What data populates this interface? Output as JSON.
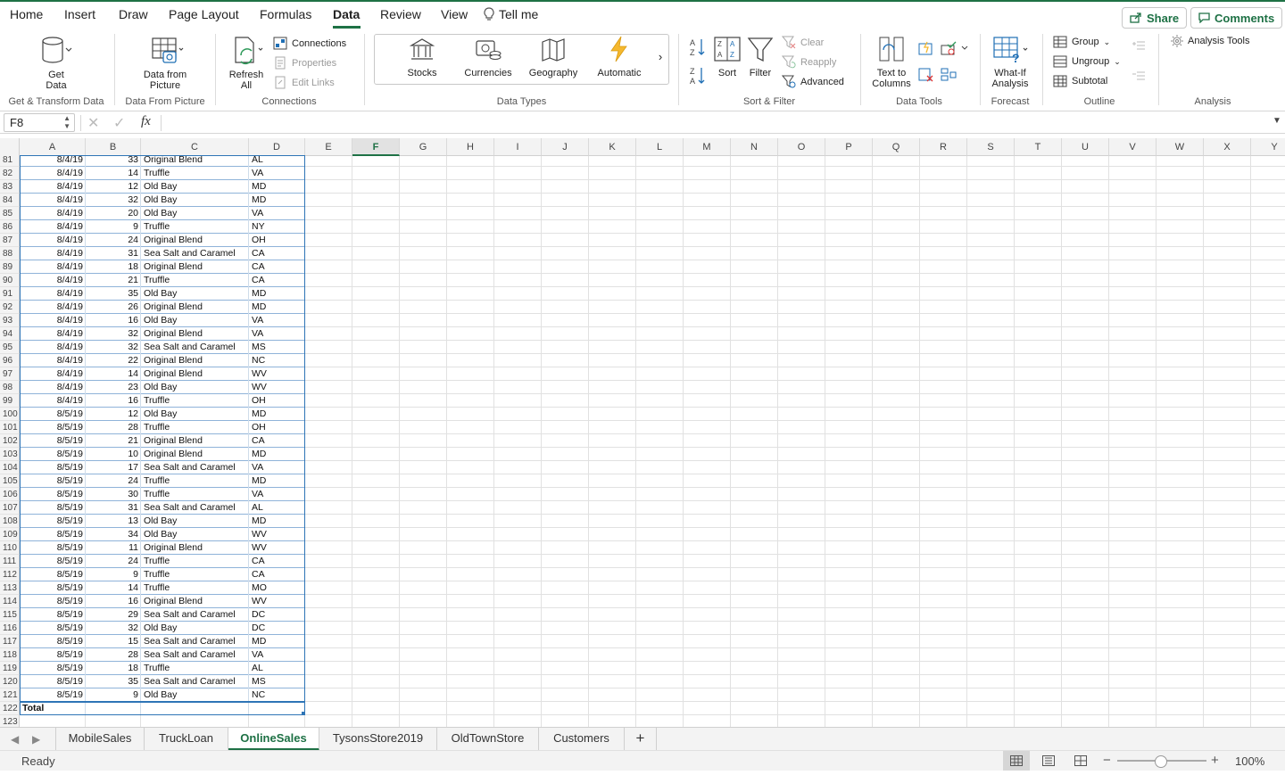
{
  "ribbon_tabs": [
    "Home",
    "Insert",
    "Draw",
    "Page Layout",
    "Formulas",
    "Data",
    "Review",
    "View",
    "Tell me"
  ],
  "active_tab": "Data",
  "share_label": "Share",
  "comments_label": "Comments",
  "ribbon": {
    "get_data": "Get Data",
    "data_from_picture": "Data from Picture",
    "refresh_all": "Refresh All",
    "connections": "Connections",
    "properties": "Properties",
    "edit_links": "Edit Links",
    "stocks": "Stocks",
    "currencies": "Currencies",
    "geography": "Geography",
    "automatic": "Automatic",
    "sort": "Sort",
    "filter": "Filter",
    "clear": "Clear",
    "reapply": "Reapply",
    "advanced": "Advanced",
    "text_to_columns": "Text to Columns",
    "what_if": "What-If Analysis",
    "group": "Group",
    "ungroup": "Ungroup",
    "subtotal": "Subtotal",
    "analysis_tools": "Analysis Tools",
    "groups": {
      "get_transform": "Get & Transform Data",
      "data_from_picture": "Data From Picture",
      "connections": "Connections",
      "data_types": "Data Types",
      "sort_filter": "Sort & Filter",
      "data_tools": "Data Tools",
      "forecast": "Forecast",
      "outline": "Outline",
      "analysis": "Analysis"
    }
  },
  "formula_bar": {
    "name_box": "F8",
    "fx": "fx",
    "formula": ""
  },
  "columns": [
    "A",
    "B",
    "C",
    "D",
    "E",
    "F",
    "G",
    "H",
    "I",
    "J",
    "K",
    "L",
    "M",
    "N",
    "O",
    "P",
    "Q",
    "R",
    "S",
    "T",
    "U",
    "V",
    "W",
    "X",
    "Y"
  ],
  "selected_column": "F",
  "rows": [
    {
      "n": "81",
      "date": "8/4/19",
      "qty": "33",
      "flavor": "Original Blend",
      "state": "AL"
    },
    {
      "n": "82",
      "date": "8/4/19",
      "qty": "14",
      "flavor": "Truffle",
      "state": "VA"
    },
    {
      "n": "83",
      "date": "8/4/19",
      "qty": "12",
      "flavor": "Old Bay",
      "state": "MD"
    },
    {
      "n": "84",
      "date": "8/4/19",
      "qty": "32",
      "flavor": "Old Bay",
      "state": "MD"
    },
    {
      "n": "85",
      "date": "8/4/19",
      "qty": "20",
      "flavor": "Old Bay",
      "state": "VA"
    },
    {
      "n": "86",
      "date": "8/4/19",
      "qty": "9",
      "flavor": "Truffle",
      "state": "NY"
    },
    {
      "n": "87",
      "date": "8/4/19",
      "qty": "24",
      "flavor": "Original Blend",
      "state": "OH"
    },
    {
      "n": "88",
      "date": "8/4/19",
      "qty": "31",
      "flavor": "Sea Salt and Caramel",
      "state": "CA"
    },
    {
      "n": "89",
      "date": "8/4/19",
      "qty": "18",
      "flavor": "Original Blend",
      "state": "CA"
    },
    {
      "n": "90",
      "date": "8/4/19",
      "qty": "21",
      "flavor": "Truffle",
      "state": "CA"
    },
    {
      "n": "91",
      "date": "8/4/19",
      "qty": "35",
      "flavor": "Old Bay",
      "state": "MD"
    },
    {
      "n": "92",
      "date": "8/4/19",
      "qty": "26",
      "flavor": "Original Blend",
      "state": "MD"
    },
    {
      "n": "93",
      "date": "8/4/19",
      "qty": "16",
      "flavor": "Old Bay",
      "state": "VA"
    },
    {
      "n": "94",
      "date": "8/4/19",
      "qty": "32",
      "flavor": "Original Blend",
      "state": "VA"
    },
    {
      "n": "95",
      "date": "8/4/19",
      "qty": "32",
      "flavor": "Sea Salt and Caramel",
      "state": "MS"
    },
    {
      "n": "96",
      "date": "8/4/19",
      "qty": "22",
      "flavor": "Original Blend",
      "state": "NC"
    },
    {
      "n": "97",
      "date": "8/4/19",
      "qty": "14",
      "flavor": "Original Blend",
      "state": "WV"
    },
    {
      "n": "98",
      "date": "8/4/19",
      "qty": "23",
      "flavor": "Old Bay",
      "state": "WV"
    },
    {
      "n": "99",
      "date": "8/4/19",
      "qty": "16",
      "flavor": "Truffle",
      "state": "OH"
    },
    {
      "n": "100",
      "date": "8/5/19",
      "qty": "12",
      "flavor": "Old Bay",
      "state": "MD"
    },
    {
      "n": "101",
      "date": "8/5/19",
      "qty": "28",
      "flavor": "Truffle",
      "state": "OH"
    },
    {
      "n": "102",
      "date": "8/5/19",
      "qty": "21",
      "flavor": "Original Blend",
      "state": "CA"
    },
    {
      "n": "103",
      "date": "8/5/19",
      "qty": "10",
      "flavor": "Original Blend",
      "state": "MD"
    },
    {
      "n": "104",
      "date": "8/5/19",
      "qty": "17",
      "flavor": "Sea Salt and Caramel",
      "state": "VA"
    },
    {
      "n": "105",
      "date": "8/5/19",
      "qty": "24",
      "flavor": "Truffle",
      "state": "MD"
    },
    {
      "n": "106",
      "date": "8/5/19",
      "qty": "30",
      "flavor": "Truffle",
      "state": "VA"
    },
    {
      "n": "107",
      "date": "8/5/19",
      "qty": "31",
      "flavor": "Sea Salt and Caramel",
      "state": "AL"
    },
    {
      "n": "108",
      "date": "8/5/19",
      "qty": "13",
      "flavor": "Old Bay",
      "state": "MD"
    },
    {
      "n": "109",
      "date": "8/5/19",
      "qty": "34",
      "flavor": "Old Bay",
      "state": "WV"
    },
    {
      "n": "110",
      "date": "8/5/19",
      "qty": "11",
      "flavor": "Original Blend",
      "state": "WV"
    },
    {
      "n": "111",
      "date": "8/5/19",
      "qty": "24",
      "flavor": "Truffle",
      "state": "CA"
    },
    {
      "n": "112",
      "date": "8/5/19",
      "qty": "9",
      "flavor": "Truffle",
      "state": "CA"
    },
    {
      "n": "113",
      "date": "8/5/19",
      "qty": "14",
      "flavor": "Truffle",
      "state": "MO"
    },
    {
      "n": "114",
      "date": "8/5/19",
      "qty": "16",
      "flavor": "Original Blend",
      "state": "WV"
    },
    {
      "n": "115",
      "date": "8/5/19",
      "qty": "29",
      "flavor": "Sea Salt and Caramel",
      "state": "DC"
    },
    {
      "n": "116",
      "date": "8/5/19",
      "qty": "32",
      "flavor": "Old Bay",
      "state": "DC"
    },
    {
      "n": "117",
      "date": "8/5/19",
      "qty": "15",
      "flavor": "Sea Salt and Caramel",
      "state": "MD"
    },
    {
      "n": "118",
      "date": "8/5/19",
      "qty": "28",
      "flavor": "Sea Salt and Caramel",
      "state": "VA"
    },
    {
      "n": "119",
      "date": "8/5/19",
      "qty": "18",
      "flavor": "Truffle",
      "state": "AL"
    },
    {
      "n": "120",
      "date": "8/5/19",
      "qty": "35",
      "flavor": "Sea Salt and Caramel",
      "state": "MS"
    },
    {
      "n": "121",
      "date": "8/5/19",
      "qty": "9",
      "flavor": "Old Bay",
      "state": "NC"
    }
  ],
  "total_row": {
    "n": "122",
    "label": "Total"
  },
  "empty_row": {
    "n": "123"
  },
  "sheet_tabs": [
    "MobileSales",
    "TruckLoan",
    "OnlineSales",
    "TysonsStore2019",
    "OldTownStore",
    "Customers"
  ],
  "active_sheet": "OnlineSales",
  "add_sheet": "+",
  "status": "Ready",
  "zoom": "100%",
  "colors": {
    "accent": "#1e7145",
    "table_border": "#2e75b6"
  }
}
